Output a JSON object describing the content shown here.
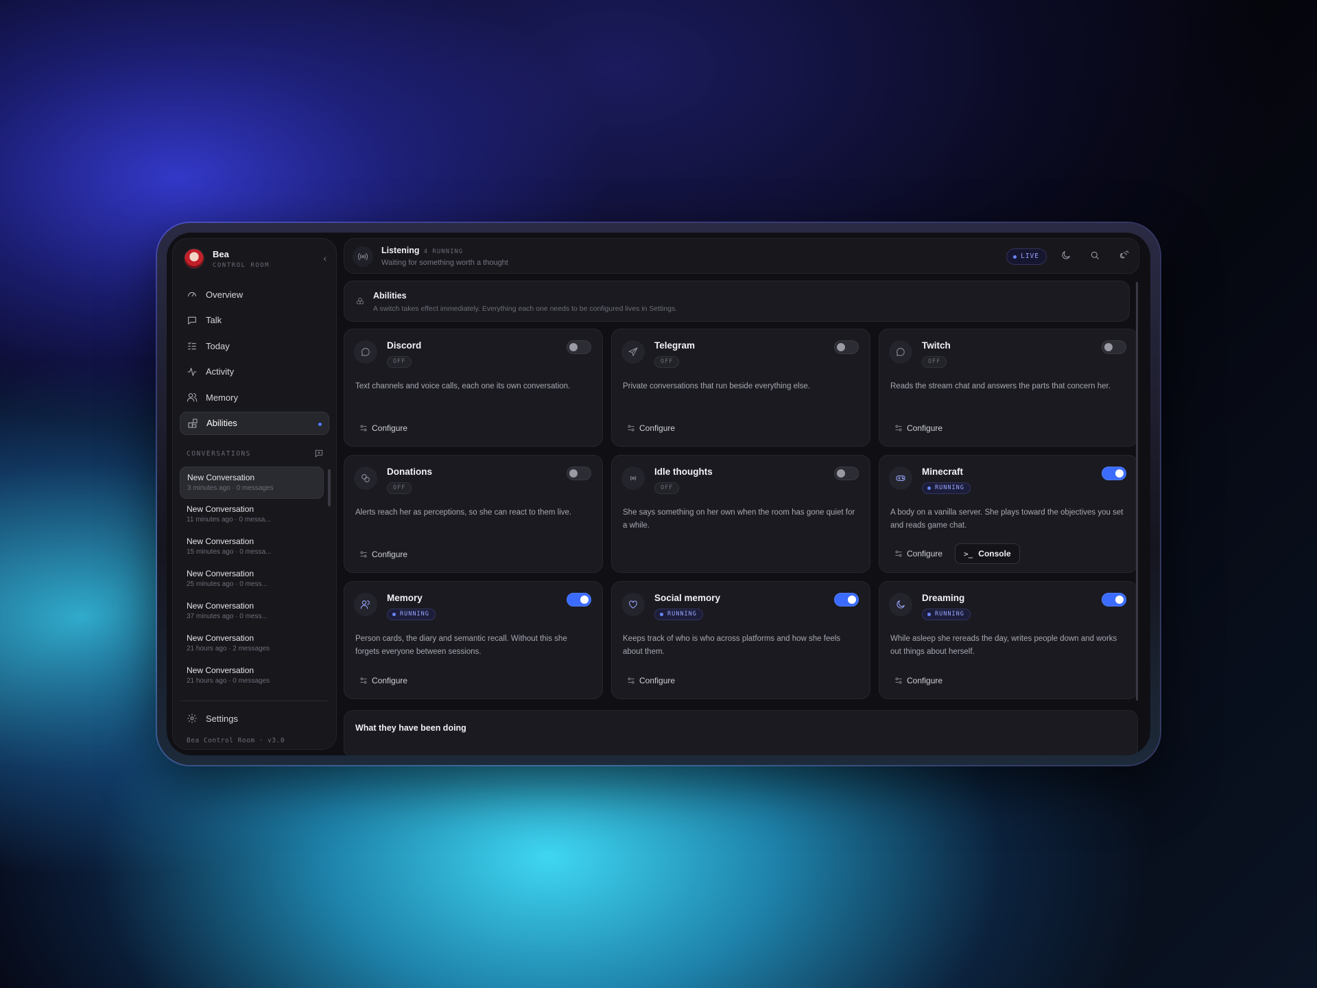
{
  "brand": {
    "name": "Bea",
    "subtitle": "CONTROL ROOM",
    "version": "Bea Control Room · v3.0"
  },
  "nav": [
    {
      "label": "Overview",
      "icon": "gauge-icon"
    },
    {
      "label": "Talk",
      "icon": "chat-icon"
    },
    {
      "label": "Today",
      "icon": "checklist-icon"
    },
    {
      "label": "Activity",
      "icon": "activity-icon"
    },
    {
      "label": "Memory",
      "icon": "people-icon"
    },
    {
      "label": "Abilities",
      "icon": "blocks-icon",
      "active": true
    }
  ],
  "conversations": {
    "heading": "CONVERSATIONS",
    "items": [
      {
        "title": "New Conversation",
        "meta": "3 minutes ago · 0 messages"
      },
      {
        "title": "New Conversation",
        "meta": "11 minutes ago · 0 messa..."
      },
      {
        "title": "New Conversation",
        "meta": "15 minutes ago · 0 messa..."
      },
      {
        "title": "New Conversation",
        "meta": "25 minutes ago · 0 mess..."
      },
      {
        "title": "New Conversation",
        "meta": "37 minutes ago · 0 mess..."
      },
      {
        "title": "New Conversation",
        "meta": "21 hours ago · 2 messages"
      },
      {
        "title": "New Conversation",
        "meta": "21 hours ago · 0 messages"
      }
    ]
  },
  "settings_label": "Settings",
  "topbar": {
    "title": "Listening",
    "count": "4 RUNNING",
    "subtitle": "Waiting for something worth a thought",
    "live": "LIVE"
  },
  "abilities": {
    "title": "Abilities",
    "subtitle": "A switch takes effect immediately. Everything each one needs to be configured lives in Settings.",
    "cards": [
      {
        "title": "Discord",
        "status": "OFF",
        "on": false,
        "icon": "chat-bubble-icon",
        "desc": "Text channels and voice calls, each one its own conversation.",
        "action": "Configure"
      },
      {
        "title": "Telegram",
        "status": "OFF",
        "on": false,
        "icon": "send-icon",
        "desc": "Private conversations that run beside everything else.",
        "action": "Configure"
      },
      {
        "title": "Twitch",
        "status": "OFF",
        "on": false,
        "icon": "chat-bubble-icon",
        "desc": "Reads the stream chat and answers the parts that concern her.",
        "action": "Configure"
      },
      {
        "title": "Donations",
        "status": "OFF",
        "on": false,
        "icon": "coins-icon",
        "desc": "Alerts reach her as perceptions, so she can react to them live.",
        "action": "Configure"
      },
      {
        "title": "Idle thoughts",
        "status": "OFF",
        "on": false,
        "icon": "broadcast-icon",
        "desc": "She says something on her own when the room has gone quiet for a while.",
        "action": ""
      },
      {
        "title": "Minecraft",
        "status": "RUNNING",
        "on": true,
        "icon": "gamepad-icon",
        "desc": "A body on a vanilla server. She plays toward the objectives you set and reads game chat.",
        "action": "Configure",
        "extra": "Console"
      },
      {
        "title": "Memory",
        "status": "RUNNING",
        "on": true,
        "icon": "people-icon",
        "desc": "Person cards, the diary and semantic recall. Without this she forgets everyone between sessions.",
        "action": "Configure"
      },
      {
        "title": "Social memory",
        "status": "RUNNING",
        "on": true,
        "icon": "heart-icon",
        "desc": "Keeps track of who is who across platforms and how she feels about them.",
        "action": "Configure"
      },
      {
        "title": "Dreaming",
        "status": "RUNNING",
        "on": true,
        "icon": "moon-icon",
        "desc": "While asleep she rereads the day, writes people down and works out things about herself.",
        "action": "Configure"
      }
    ]
  },
  "doing": {
    "title": "What they have been doing"
  }
}
